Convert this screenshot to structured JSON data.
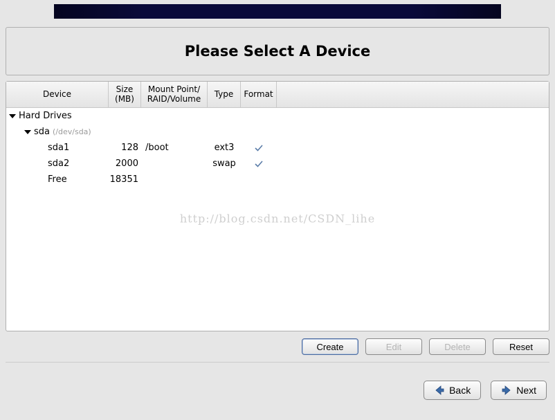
{
  "title": "Please Select A Device",
  "columns": {
    "device": "Device",
    "size": "Size (MB)",
    "mount": "Mount Point/\nRAID/Volume",
    "type": "Type",
    "format": "Format"
  },
  "tree": {
    "root_label": "Hard Drives",
    "disk_label": "sda",
    "disk_path": "(/dev/sda)",
    "partitions": [
      {
        "name": "sda1",
        "size": "128",
        "mount": "/boot",
        "type": "ext3",
        "format": true
      },
      {
        "name": "sda2",
        "size": "2000",
        "mount": "",
        "type": "swap",
        "format": true
      },
      {
        "name": "Free",
        "size": "18351",
        "mount": "",
        "type": "",
        "format": false
      }
    ]
  },
  "watermark": "http://blog.csdn.net/CSDN_lihe",
  "buttons": {
    "create": "Create",
    "edit": "Edit",
    "delete": "Delete",
    "reset": "Reset",
    "back": "Back",
    "next": "Next"
  }
}
